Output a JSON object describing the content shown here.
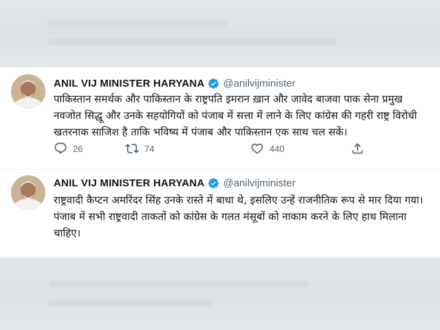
{
  "tweets": [
    {
      "author": "ANIL VIJ MINISTER HARYANA",
      "handle": "@anilvijminister",
      "text": "पाकिस्तान समर्थक और पाकिस्तान के राष्ट्रपति इमरान ख़ान और जावेद बाजवा पाक सेना प्रमुख नवजोत सिद्धू और उनके सहयोगियों को पंजाब में सत्ता में लाने के लिए कांग्रेस की गहरी राष्ट्र विरोधी खतरनाक साजिश है ताकि भविष्य में पंजाब और पाकिस्तान एक साथ चल सकें।",
      "replies": "26",
      "retweets": "74",
      "likes": "440"
    },
    {
      "author": "ANIL VIJ MINISTER HARYANA",
      "handle": "@anilvijminister",
      "text": "राष्ट्रवादी कैप्टन अमरिंदर सिंह उनके रास्ते में बाधा थे, इसलिए उन्हें राजनीतिक रूप से मार दिया गया।  पंजाब में सभी राष्ट्रवादी ताकतों को कांग्रेस के गलत मंसूबों को नाकाम करने के लिए हाथ मिलाना चाहिए।"
    }
  ],
  "colors": {
    "verified": "#1d9bf0",
    "icon": "#536471",
    "text": "#0f1419"
  },
  "icons": [
    "reply-icon",
    "retweet-icon",
    "like-icon",
    "share-icon",
    "verified-badge-icon"
  ]
}
